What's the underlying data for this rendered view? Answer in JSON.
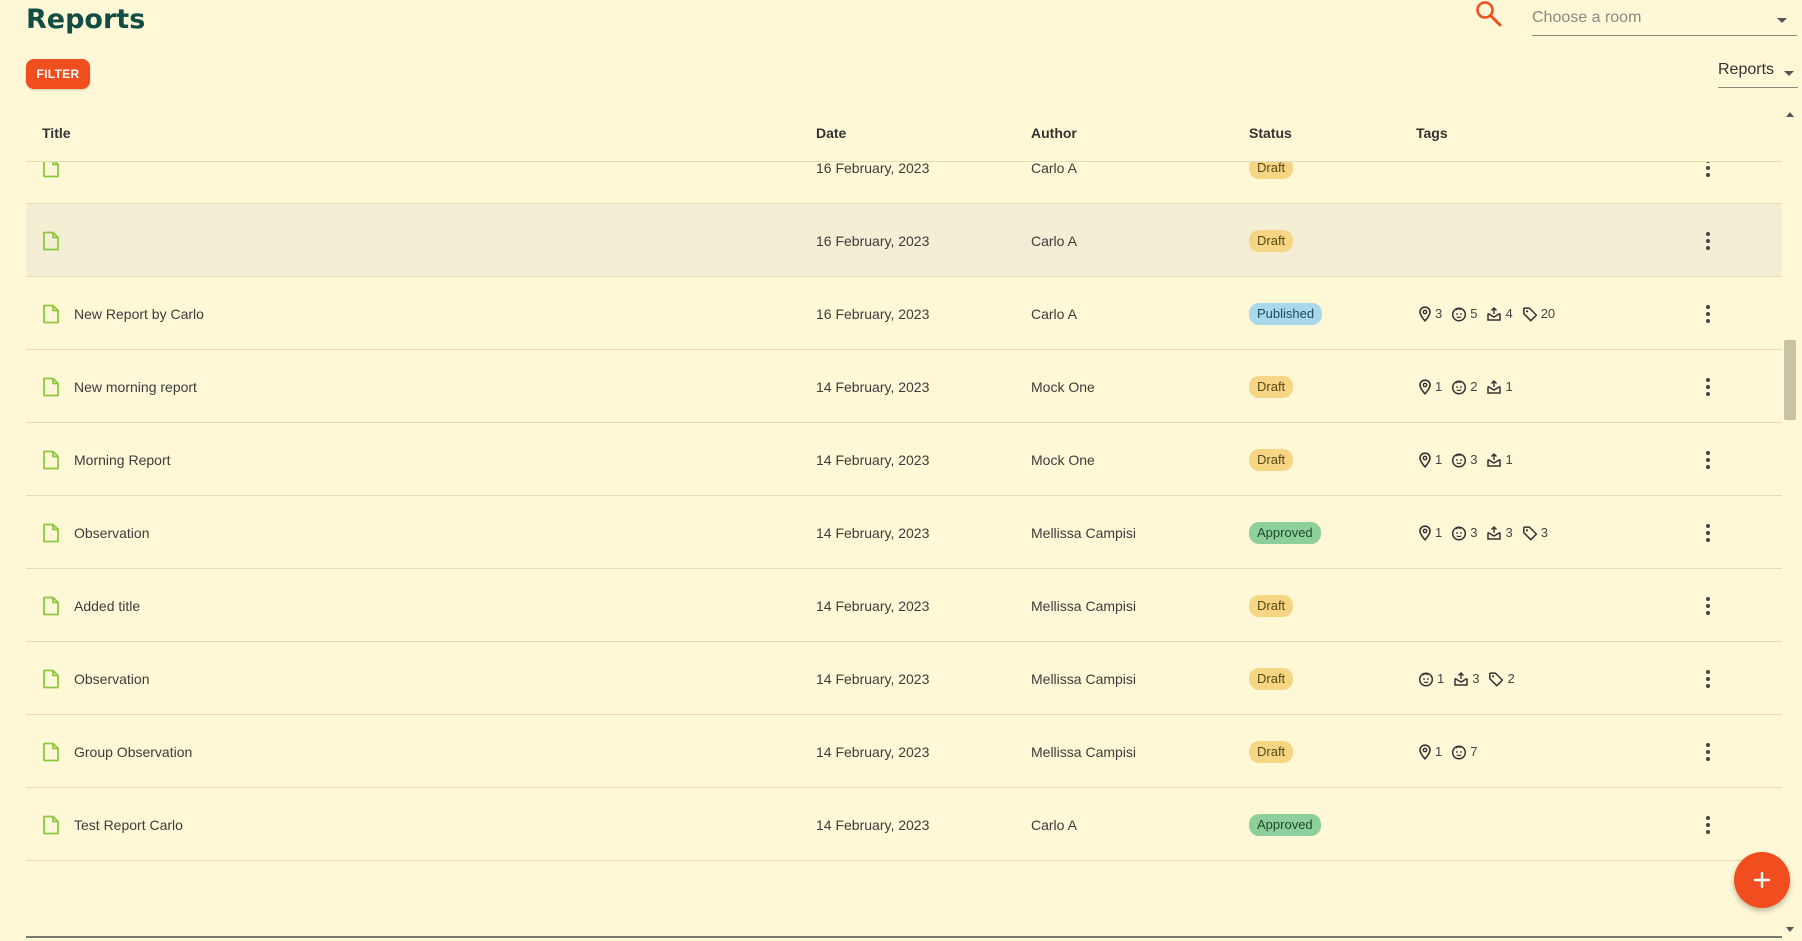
{
  "header": {
    "title": "Reports",
    "room_placeholder": "Choose a room",
    "filter_label": "FILTER",
    "view_select": "Reports"
  },
  "colors": {
    "accent": "#f04e1f",
    "title": "#124d45",
    "background": "#fff8d6",
    "file_icon": "#8dc63f"
  },
  "columns": {
    "title": "Title",
    "date": "Date",
    "author": "Author",
    "status": "Status",
    "tags": "Tags"
  },
  "rows": [
    {
      "title": "",
      "date": "16 February, 2023",
      "author": "Carlo A",
      "status": "Draft",
      "status_type": "draft",
      "tags": []
    },
    {
      "title": "",
      "date": "16 February, 2023",
      "author": "Carlo A",
      "status": "Draft",
      "status_type": "draft",
      "tags": []
    },
    {
      "title": "",
      "date": "16 February, 2023",
      "author": "Carlo A",
      "status": "Draft",
      "status_type": "draft",
      "tags": []
    },
    {
      "title": "New Report by Carlo",
      "date": "16 February, 2023",
      "author": "Carlo A",
      "status": "Published",
      "status_type": "published",
      "tags": [
        {
          "icon": "location-pin",
          "count": "3"
        },
        {
          "icon": "child-face",
          "count": "5"
        },
        {
          "icon": "learning-box",
          "count": "4"
        },
        {
          "icon": "tag",
          "count": "20"
        }
      ]
    },
    {
      "title": "New morning report",
      "date": "14 February, 2023",
      "author": "Mock One",
      "status": "Draft",
      "status_type": "draft",
      "tags": [
        {
          "icon": "location-pin",
          "count": "1"
        },
        {
          "icon": "child-face",
          "count": "2"
        },
        {
          "icon": "learning-box",
          "count": "1"
        }
      ]
    },
    {
      "title": "Morning Report",
      "date": "14 February, 2023",
      "author": "Mock One",
      "status": "Draft",
      "status_type": "draft",
      "tags": [
        {
          "icon": "location-pin",
          "count": "1"
        },
        {
          "icon": "child-face",
          "count": "3"
        },
        {
          "icon": "learning-box",
          "count": "1"
        }
      ]
    },
    {
      "title": "Observation",
      "date": "14 February, 2023",
      "author": "Mellissa Campisi",
      "status": "Approved",
      "status_type": "approved",
      "tags": [
        {
          "icon": "location-pin",
          "count": "1"
        },
        {
          "icon": "child-face",
          "count": "3"
        },
        {
          "icon": "learning-box",
          "count": "3"
        },
        {
          "icon": "tag",
          "count": "3"
        }
      ]
    },
    {
      "title": "Added title",
      "date": "14 February, 2023",
      "author": "Mellissa Campisi",
      "status": "Draft",
      "status_type": "draft",
      "tags": []
    },
    {
      "title": "Observation",
      "date": "14 February, 2023",
      "author": "Mellissa Campisi",
      "status": "Draft",
      "status_type": "draft",
      "tags": [
        {
          "icon": "child-face",
          "count": "1"
        },
        {
          "icon": "learning-box",
          "count": "3"
        },
        {
          "icon": "tag",
          "count": "2"
        }
      ]
    },
    {
      "title": "Group Observation",
      "date": "14 February, 2023",
      "author": "Mellissa Campisi",
      "status": "Draft",
      "status_type": "draft",
      "tags": [
        {
          "icon": "location-pin",
          "count": "1"
        },
        {
          "icon": "child-face",
          "count": "7"
        }
      ]
    },
    {
      "title": "Test Report Carlo",
      "date": "14 February, 2023",
      "author": "Carlo A",
      "status": "Approved",
      "status_type": "approved",
      "tags": []
    }
  ]
}
